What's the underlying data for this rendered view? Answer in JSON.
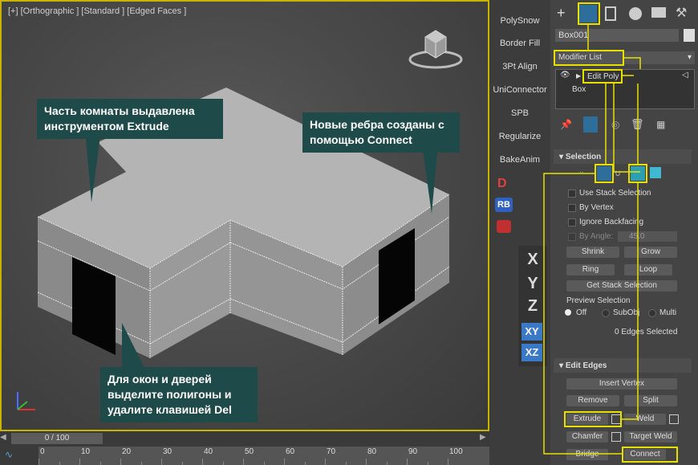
{
  "viewport": {
    "label": "[+] [Orthographic ] [Standard ] [Edged Faces ]",
    "callouts": {
      "extrude": "Часть комнаты выдавлена инструментом Extrude",
      "connect": "Новые ребра созданы с помощью Connect",
      "delete": "Для окон и дверей выделите полигоны и удалите клавишей Del"
    }
  },
  "timeline": {
    "slider_label": "0 / 100",
    "ticks": [
      "0",
      "10",
      "20",
      "30",
      "40",
      "50",
      "60",
      "70",
      "80",
      "90",
      "100"
    ]
  },
  "toolbar": {
    "buttons": [
      "PolySnow",
      "Border Fill",
      "3Pt Align",
      "UniConnector",
      "SPB",
      "Regularize",
      "BakeAnim"
    ],
    "rb_label": "RB",
    "axes": {
      "x": "X",
      "y": "Y",
      "z": "Z",
      "xy": "XY",
      "xz": "XZ"
    }
  },
  "panel": {
    "object_name": "Box001",
    "modifier_list": "Modifier List",
    "stack": [
      "Edit Poly",
      "Box"
    ],
    "selection": {
      "title": "Selection",
      "use_stack": "Use Stack Selection",
      "by_vertex": "By Vertex",
      "ignore_backfacing": "Ignore Backfacing",
      "by_angle": "By Angle:",
      "angle_value": "45.0",
      "shrink": "Shrink",
      "grow": "Grow",
      "ring": "Ring",
      "loop": "Loop",
      "get_stack": "Get Stack Selection",
      "preview_title": "Preview Selection",
      "preview_options": [
        "Off",
        "SubObj",
        "Multi"
      ],
      "status": "0 Edges Selected"
    },
    "edit_edges": {
      "title": "Edit Edges",
      "insert_vertex": "Insert Vertex",
      "remove": "Remove",
      "split": "Split",
      "extrude": "Extrude",
      "weld": "Weld",
      "chamfer": "Chamfer",
      "target_weld": "Target Weld",
      "bridge": "Bridge",
      "connect": "Connect"
    }
  },
  "colors": {
    "highlight": "#e8e000",
    "callout": "#1f4a4a",
    "accent": "#3fb8d0"
  }
}
